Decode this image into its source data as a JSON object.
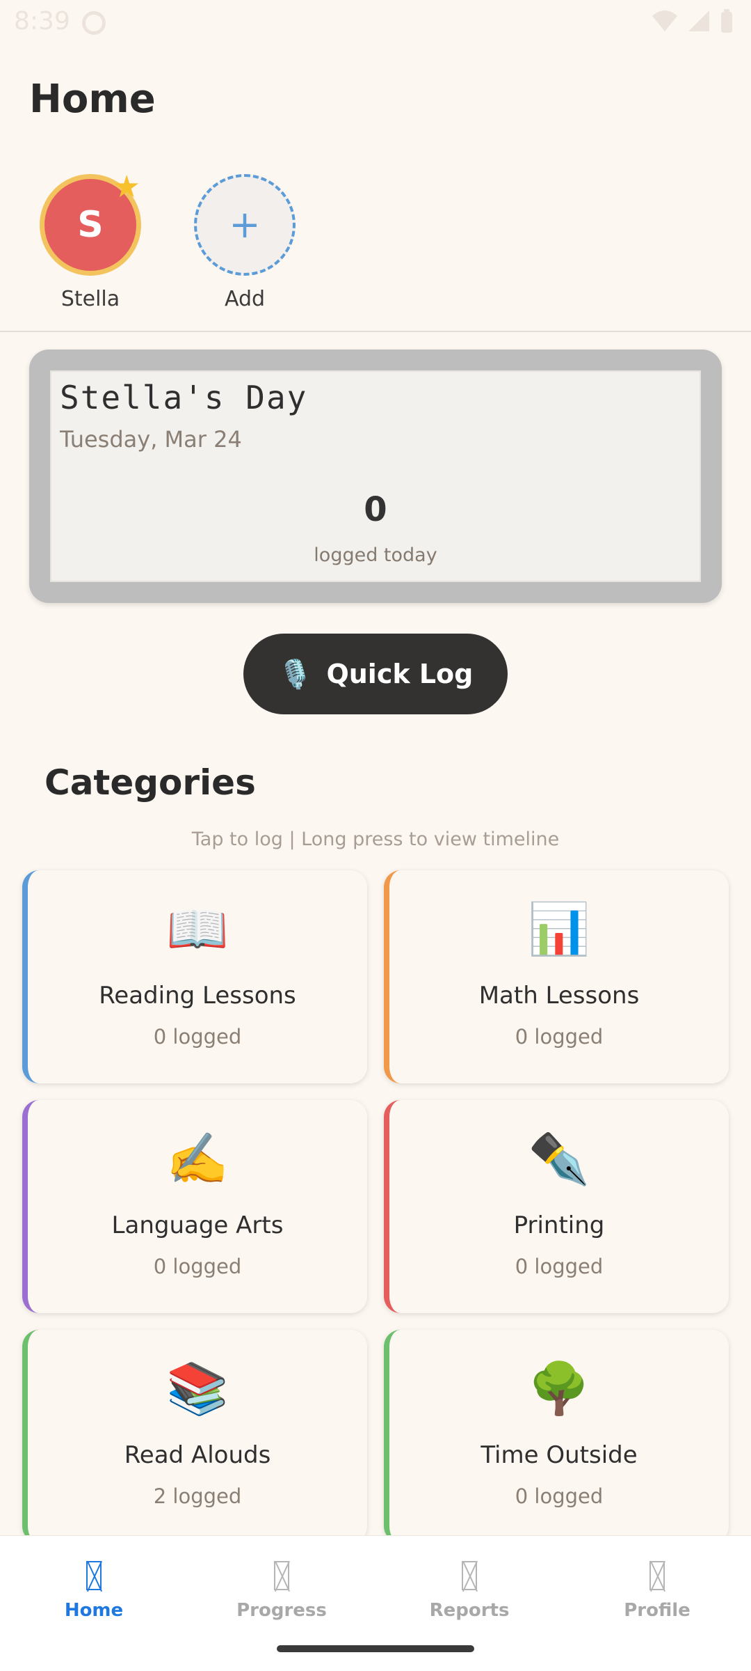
{
  "status_bar": {
    "time": "8:39"
  },
  "header": {
    "title": "Home"
  },
  "children": [
    {
      "initial": "S",
      "name": "Stella",
      "selected": true
    },
    {
      "initial": "+",
      "name": "Add",
      "selected": false
    }
  ],
  "day_card": {
    "title": "Stella's Day",
    "date": "Tuesday, Mar 24",
    "count": "0",
    "count_label": "logged today"
  },
  "quick_log": {
    "label": "Quick Log",
    "icon": "🎙️"
  },
  "categories": {
    "title": "Categories",
    "hint": "Tap to log  |  Long press to view timeline",
    "items": [
      {
        "icon": "📖",
        "label": "Reading Lessons",
        "count": "0 logged",
        "accent": "#5a9bd8"
      },
      {
        "icon": "📊",
        "label": "Math Lessons",
        "count": "0 logged",
        "accent": "#f0994a"
      },
      {
        "icon": "✍️",
        "label": "Language Arts",
        "count": "0 logged",
        "accent": "#9b6fd1"
      },
      {
        "icon": "✒️",
        "label": "Printing",
        "count": "0 logged",
        "accent": "#e55e5e"
      },
      {
        "icon": "📚",
        "label": "Read Alouds",
        "count": "2 logged",
        "accent": "#6cbf6c"
      },
      {
        "icon": "🌳",
        "label": "Time Outside",
        "count": "0 logged",
        "accent": "#6cbf6c"
      }
    ]
  },
  "bottom_nav": {
    "items": [
      {
        "label": "Home",
        "active": true
      },
      {
        "label": "Progress",
        "active": false
      },
      {
        "label": "Reports",
        "active": false
      },
      {
        "label": "Profile",
        "active": false
      }
    ]
  }
}
